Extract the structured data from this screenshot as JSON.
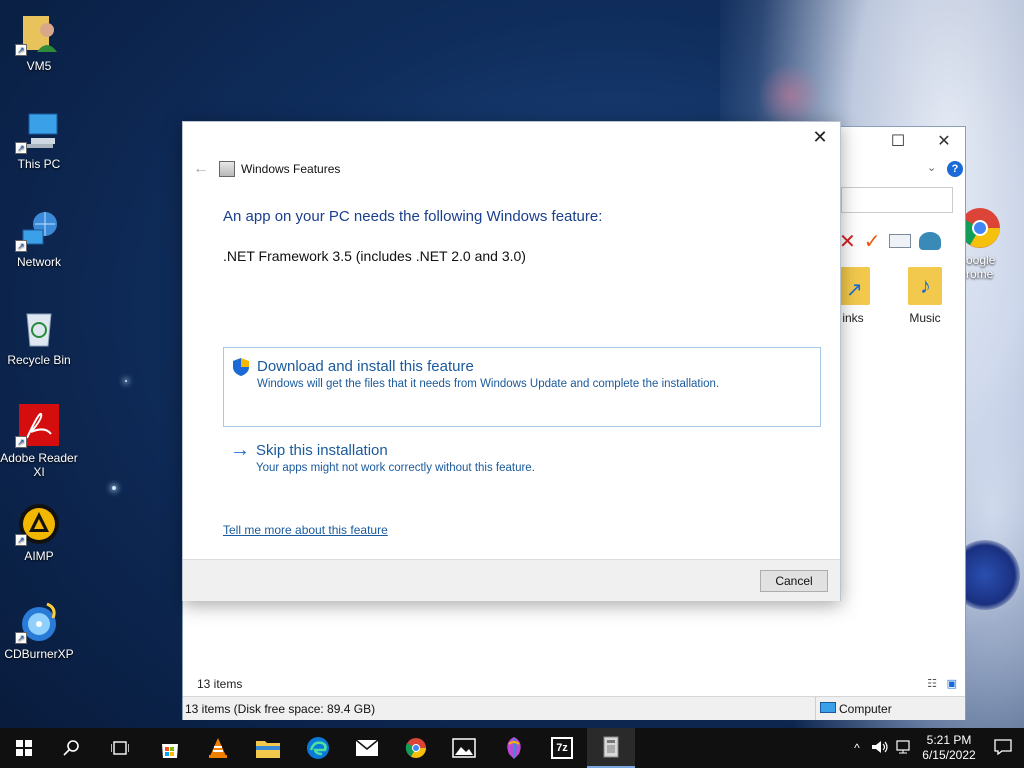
{
  "desktop": {
    "icons": [
      {
        "label": "VM5",
        "icon": "user-folder-icon"
      },
      {
        "label": "This PC",
        "icon": "computer-icon"
      },
      {
        "label": "Network",
        "icon": "network-icon"
      },
      {
        "label": "Recycle Bin",
        "icon": "recycle-bin-icon"
      },
      {
        "label": "Adobe Reader XI",
        "icon": "adobe-reader-icon"
      },
      {
        "label": "AIMP",
        "icon": "aimp-icon"
      },
      {
        "label": "CDBurnerXP",
        "icon": "cdburnerxp-icon"
      }
    ],
    "chrome_partial_label_1": "oogle",
    "chrome_partial_label_2": "rome"
  },
  "explorer": {
    "folders": [
      {
        "label": "inks"
      },
      {
        "label": "Music"
      }
    ],
    "status_items": "13 items",
    "bottom_status": "13 items (Disk free space: 89.4 GB)",
    "bottom_location": "Computer"
  },
  "dialog": {
    "title": "Windows Features",
    "heading": "An app on your PC needs the following Windows feature:",
    "feature_name": ".NET Framework 3.5 (includes .NET 2.0 and 3.0)",
    "option_download": {
      "title": "Download and install this feature",
      "description": "Windows will get the files that it needs from Windows Update and complete the installation."
    },
    "option_skip": {
      "title": "Skip this installation",
      "description": "Your apps might not work correctly without this feature."
    },
    "link": "Tell me more about this feature",
    "cancel_label": "Cancel"
  },
  "taskbar": {
    "apps": [
      "start-icon",
      "search-icon",
      "task-view-icon",
      "store-icon",
      "vlc-icon",
      "file-explorer-icon",
      "edge-icon",
      "mail-icon",
      "chrome-icon",
      "photos-icon",
      "paint3d-icon",
      "7zip-icon",
      "windows-features-icon"
    ],
    "sevenzip_label": "7z",
    "time": "5:21 PM",
    "date": "6/15/2022"
  }
}
